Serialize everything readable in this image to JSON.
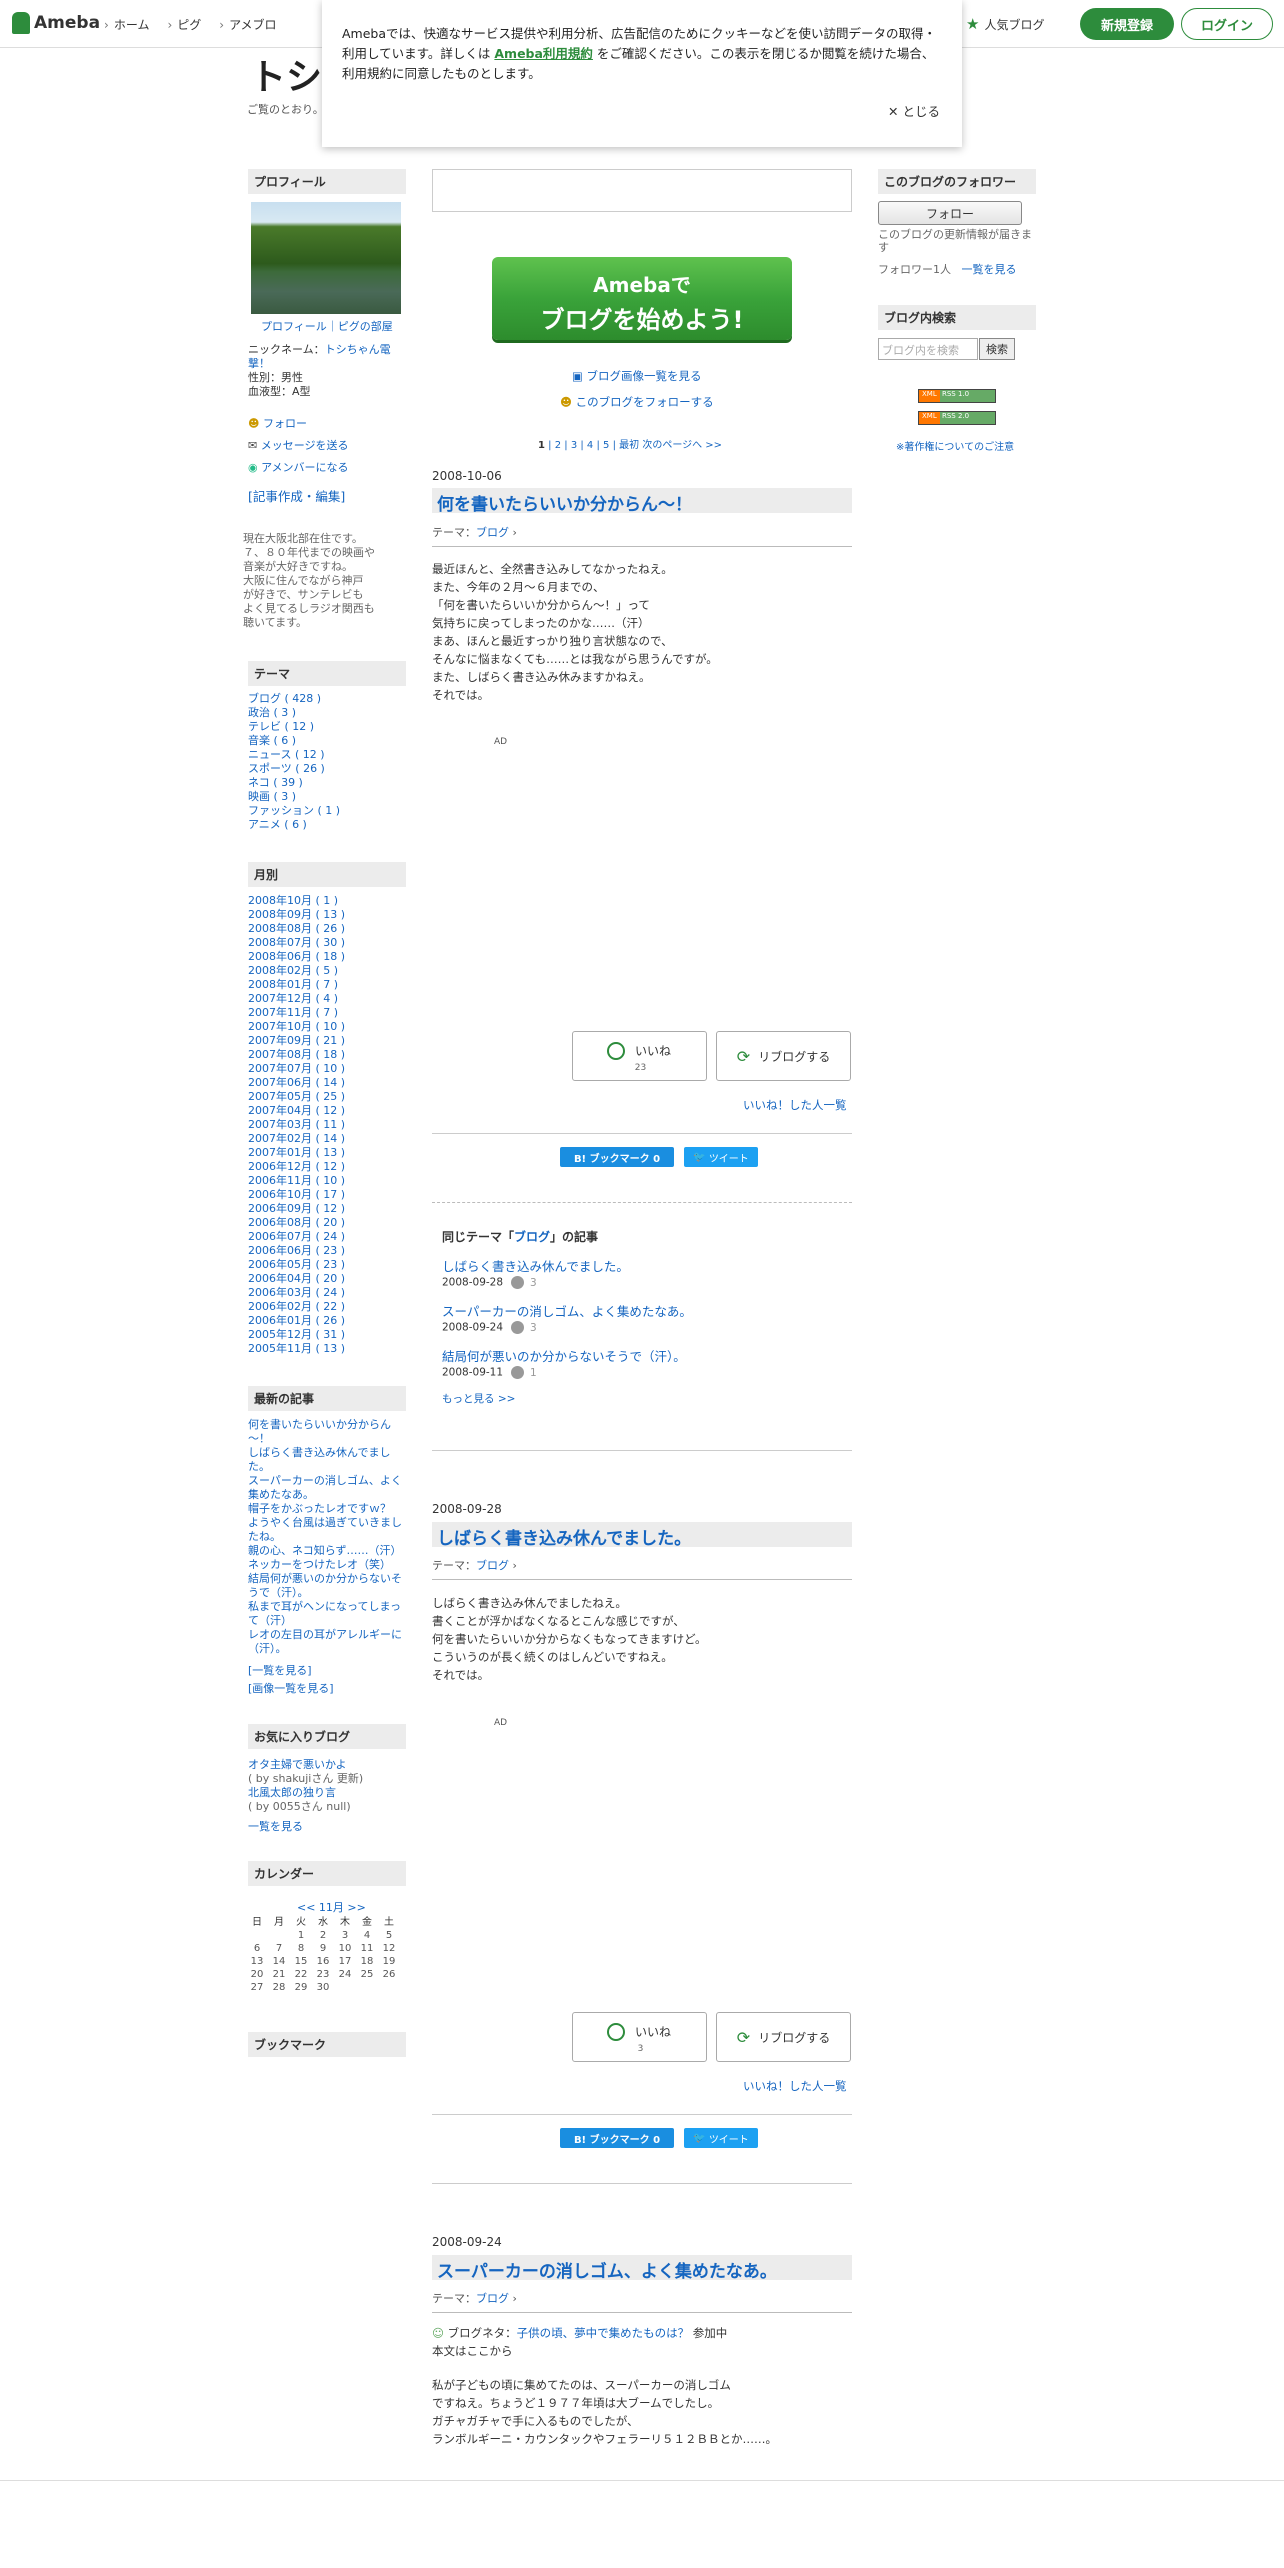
{
  "header": {
    "logo": "Ameba",
    "nav": [
      "ホーム",
      "ピグ",
      "アメブロ"
    ],
    "popular": "人気ブログ",
    "register": "新規登録",
    "login": "ログイン"
  },
  "blog": {
    "title": "トシ",
    "desc": "ご覧のとおり。"
  },
  "cookie": {
    "text1": "Amebaでは、快適なサービス提供や利用分析、広告配信のためにクッキーなどを使い訪問データの取得・利用しています。詳しくは",
    "link": "Ameba利用規約",
    "text2": "をご確認ください。この表示を閉じるか閲覧を続けた場合、利用規約に同意したものとします。",
    "close": "✕ とじる"
  },
  "left": {
    "profile_h": "プロフィール",
    "profile_links": "プロフィール｜ピグの部屋",
    "nickname_label": "ニックネーム：",
    "nickname": "トシちゃん電撃！",
    "gender": "性別：男性",
    "blood": "血液型：A型",
    "follow": "フォロー",
    "message": "メッセージを送る",
    "amember": "アメンバーになる",
    "edit": "[記事作成・編集]",
    "intro": [
      "現在大阪北部在住です。",
      "７、８０年代までの映画や",
      "音楽が大好きですね。",
      "大阪に住んでながら神戸",
      "が好きで、サンテレビも",
      "よく見てるしラジオ関西も",
      "聴いてます。"
    ],
    "theme_h": "テーマ",
    "themes": [
      "ブログ ( 428 )",
      "政治 ( 3 )",
      "テレビ ( 12 )",
      "音楽 ( 6 )",
      "ニュース ( 12 )",
      "スポーツ ( 26 )",
      "ネコ ( 39 )",
      "映画 ( 3 )",
      "ファッション ( 1 )",
      "アニメ ( 6 )"
    ],
    "month_h": "月別",
    "months": [
      "2008年10月 ( 1 )",
      "2008年09月 ( 13 )",
      "2008年08月 ( 26 )",
      "2008年07月 ( 30 )",
      "2008年06月 ( 18 )",
      "2008年02月 ( 5 )",
      "2008年01月 ( 7 )",
      "2007年12月 ( 4 )",
      "2007年11月 ( 7 )",
      "2007年10月 ( 10 )",
      "2007年09月 ( 21 )",
      "2007年08月 ( 18 )",
      "2007年07月 ( 10 )",
      "2007年06月 ( 14 )",
      "2007年05月 ( 25 )",
      "2007年04月 ( 12 )",
      "2007年03月 ( 11 )",
      "2007年02月 ( 14 )",
      "2007年01月 ( 13 )",
      "2006年12月 ( 12 )",
      "2006年11月 ( 10 )",
      "2006年10月 ( 17 )",
      "2006年09月 ( 12 )",
      "2006年08月 ( 20 )",
      "2006年07月 ( 24 )",
      "2006年06月 ( 23 )",
      "2006年05月 ( 23 )",
      "2006年04月 ( 20 )",
      "2006年03月 ( 24 )",
      "2006年02月 ( 22 )",
      "2006年01月 ( 26 )",
      "2005年12月 ( 31 )",
      "2005年11月 ( 13 )"
    ],
    "recent_h": "最新の記事",
    "recent": [
      "何を書いたらいいか分からん",
      "～！",
      "しばらく書き込み休んでまし",
      "た。",
      "スーパーカーの消しゴム、よく",
      "集めたなあ。",
      "帽子をかぶったレオですｗ？",
      "ようやく台風は過ぎていきまし",
      "たね。",
      "親の心、ネコ知らず……（汗）",
      "ネッカーをつけたレオ（笑）",
      "結局何が悪いのか分からないそ",
      "うで（汗）。",
      "私まで耳がヘンになってしまっ",
      "て（汗）",
      "レオの左目の耳がアレルギーに",
      "（汗）。"
    ],
    "recent_all": "[一覧を見る]",
    "recent_img": "[画像一覧を見る]",
    "fav_h": "お気に入りブログ",
    "fav": [
      "オタ主婦で悪いかよ",
      "( by shakujiさん 更新)",
      "北風太郎の独り言",
      "( by 0055さん null)"
    ],
    "fav_all": "一覧を見る",
    "cal_h": "カレンダー",
    "cal_nav": "<< 11月 >>",
    "cal_week": [
      "日",
      "月",
      "火",
      "水",
      "木",
      "金",
      "土"
    ],
    "cal_rows": [
      [
        "",
        "",
        "1",
        "2",
        "3",
        "4",
        "5"
      ],
      [
        "6",
        "7",
        "8",
        "9",
        "10",
        "11",
        "12"
      ],
      [
        "13",
        "14",
        "15",
        "16",
        "17",
        "18",
        "19"
      ],
      [
        "20",
        "21",
        "22",
        "23",
        "24",
        "25",
        "26"
      ],
      [
        "27",
        "28",
        "29",
        "30",
        "",
        "",
        ""
      ]
    ],
    "bookmark_h": "ブックマーク"
  },
  "center": {
    "banner_l1": "Amebaで",
    "banner_l2": "ブログを始めよう!",
    "img_list": "ブログ画像一覧を見る",
    "follow_blog": "このブログをフォローする",
    "pager": [
      "1",
      "2",
      "3",
      "4",
      "5"
    ],
    "pager_last": "最初  次のページへ >>",
    "theme_prefix": "テーマ：",
    "theme_name": "ブログ",
    "ad": "AD",
    "iine": "いいね",
    "reblog": "リブログする",
    "iine_list": "いいね！した人一覧",
    "hatena": "B! ブックマーク  0",
    "tweet": "ツイート",
    "entries": [
      {
        "date": "2008-10-06",
        "title": "何を書いたらいいか分からん～！",
        "body": [
          "最近ほんと、全然書き込みしてなかったねえ。",
          "また、今年の２月～６月までの、",
          "「何を書いたらいいか分からん～！」って",
          "気持ちに戻ってしまったのかな……（汗）",
          "まあ、ほんと最近すっかり独り言状態なので、",
          "そんなに悩まなくても……とは我ながら思うんですが。",
          "また、しばらく書き込み休みますかねえ。",
          "それでは。"
        ],
        "likes": "23"
      },
      {
        "date": "2008-09-28",
        "title": "しばらく書き込み休んでました。",
        "body": [
          "しばらく書き込み休んでましたねえ。",
          "書くことが浮かばなくなるとこんな感じですが、",
          "何を書いたらいいか分からなくもなってきますけど。",
          "こういうのが長く続くのはしんどいですねえ。",
          "それでは。"
        ],
        "likes": "3"
      },
      {
        "date": "2008-09-24",
        "title": "スーパーカーの消しゴム、よく集めたなあ。",
        "neta_prefix": "ブログネタ：",
        "neta": "子供の頃、夢中で集めたものは？",
        "neta_suffix": " 参加中",
        "body_head": "本文はここから",
        "body": [
          "私が子どもの頃に集めてたのは、スーパーカーの消しゴム",
          "ですねえ。ちょうど１９７７年頃は大ブームでしたし。",
          "ガチャガチャで手に入るものでしたが、",
          "ランボルギーニ・カウンタックやフェラーリ５１２ＢＢとか……。"
        ]
      }
    ],
    "related_h_prefix": "同じテーマ「",
    "related_h_theme": "ブログ",
    "related_h_suffix": "」の記事",
    "related": [
      {
        "title": "しばらく書き込み休んでました。",
        "date": "2008-09-28",
        "n": "3"
      },
      {
        "title": "スーパーカーの消しゴム、よく集めたなあ。",
        "date": "2008-09-24",
        "n": "3"
      },
      {
        "title": "結局何が悪いのか分からないそうで（汗）。",
        "date": "2008-09-11",
        "n": "1"
      }
    ],
    "related_more": "もっと見る >>"
  },
  "right": {
    "follower_h": "このブログのフォロワー",
    "follow_btn": "フォロー",
    "follow_desc": "このブログの更新情報が届きます",
    "follower_count": "フォロワー1人",
    "follower_list": "一覧を見る",
    "search_h": "ブログ内検索",
    "search_placeholder": "ブログ内を検索",
    "search_btn": "検索",
    "xml1": "RSS 1.0",
    "xml2": "RSS 2.0",
    "copyright": "※著作権についてのご注意"
  }
}
